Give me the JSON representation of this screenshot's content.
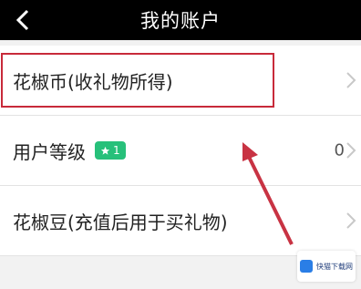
{
  "header": {
    "title": "我的账户",
    "back_icon": "back-chevron-icon"
  },
  "list": [
    {
      "label": "花椒币(收礼物所得)",
      "value": "",
      "has_chevron": true
    },
    {
      "label": "用户等级",
      "badge_text": "1",
      "value": "0",
      "has_chevron": true
    },
    {
      "label": "花椒豆(充值后用于买礼物)",
      "value": "",
      "has_chevron": true
    }
  ],
  "annotation": {
    "highlight_color": "#c82a3a"
  },
  "watermark": {
    "text": "快猫下载网"
  },
  "colors": {
    "header_bg": "#000000",
    "badge_green": "#27c07a",
    "page_bg": "#f2f2f2"
  }
}
